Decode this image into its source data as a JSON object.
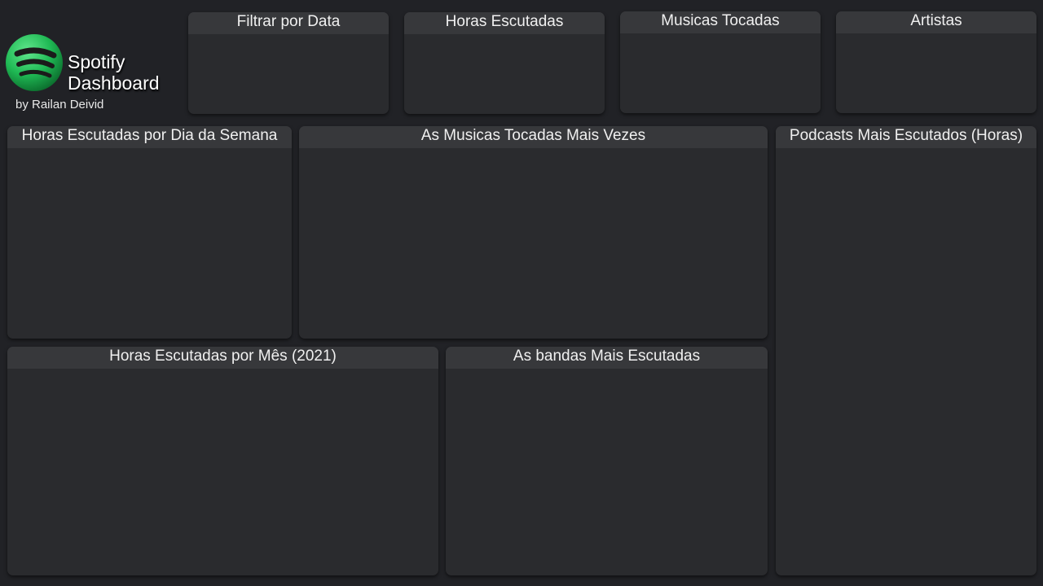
{
  "brand": {
    "title_line1": "Spotify",
    "title_line2": "Dashboard",
    "byline": "by Railan Deivid",
    "logo_icon": "spotify-logo-icon",
    "logo_color": "#1ed760"
  },
  "cards": {
    "filter_date": "Filtrar por Data",
    "hours_listened": "Horas Escutadas",
    "songs_played": "Musicas Tocadas",
    "artists": "Artistas"
  },
  "charts": {
    "weekday_hours": "Horas Escutadas por Dia da Semana",
    "top_songs": "As Musicas Tocadas Mais Vezes",
    "top_podcasts": "Podcasts Mais Escutados (Horas)",
    "monthly_hours": "Horas Escutadas por Mês (2021)",
    "top_bands": "As bandas Mais Escutadas"
  },
  "theme": {
    "background": "#212226",
    "panel": "#2a2b2e",
    "panel_header": "#37383b"
  }
}
